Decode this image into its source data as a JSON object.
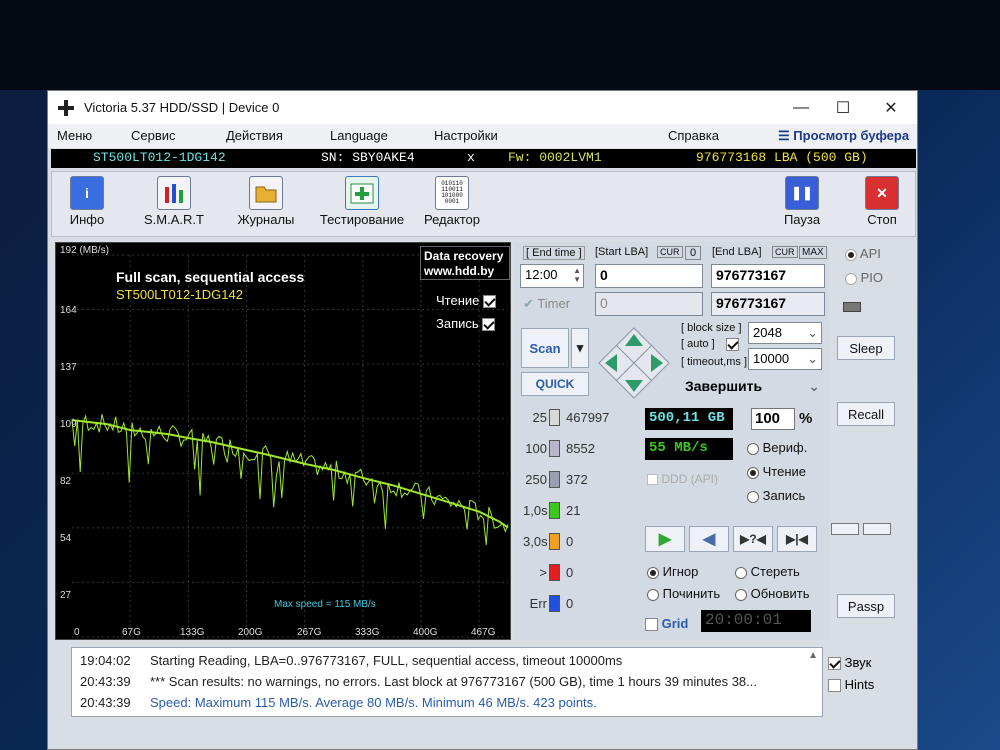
{
  "window": {
    "title": "Victoria 5.37 HDD/SSD | Device 0",
    "min": "—",
    "max": "☐",
    "close": "✕"
  },
  "menu": {
    "items": [
      "Меню",
      "Сервис",
      "Действия",
      "Language",
      "Настройки",
      "Справка"
    ],
    "buffer": "Просмотр буфера"
  },
  "device": {
    "model": "ST500LT012-1DG142",
    "serial": "SN: SBY0AKE4",
    "x": "x",
    "firmware": "Fw: 0002LVM1",
    "lba": "976773168 LBA (500 GB)"
  },
  "toolbar": {
    "info": "Инфо",
    "smart": "S.M.A.R.T",
    "logs": "Журналы",
    "testing": "Тестирование",
    "editor": "Редактор",
    "pause": "Пауза",
    "stop": "Стоп",
    "editor_icon_text": "010110\n110011\n101000\n0001"
  },
  "graph": {
    "ymax_label": "192 (MB/s)",
    "title": "Full scan, sequential access",
    "model": "ST500LT012-1DG142",
    "recovery_line1": "Data recovery",
    "recovery_line2": "www.hdd.by",
    "read_label": "Чтение",
    "write_label": "Запись",
    "max_speed": "Max speed = 115 MB/s",
    "yticks": [
      "164",
      "137",
      "109",
      "82",
      "54",
      "27",
      "0"
    ],
    "xticks": [
      "67G",
      "133G",
      "200G",
      "267G",
      "333G",
      "400G",
      "467G"
    ]
  },
  "chart_data": {
    "type": "line",
    "title": "Full scan, sequential access",
    "ylabel": "(MB/s)",
    "ylim": [
      0,
      192
    ],
    "xlim_gb": [
      0,
      500
    ],
    "series": [
      {
        "name": "Чтение",
        "color": "#9ee82e",
        "x": [
          0,
          20,
          40,
          67,
          90,
          110,
          133,
          160,
          180,
          200,
          230,
          267,
          300,
          333,
          370,
          400,
          430,
          467,
          490,
          500
        ],
        "y": [
          109,
          108,
          107,
          104,
          103,
          102,
          100,
          98,
          96,
          94,
          91,
          87,
          84,
          80,
          76,
          72,
          68,
          63,
          58,
          55
        ]
      }
    ]
  },
  "controls": {
    "end_time_label": "[ End time ]",
    "start_lba_label": "[Start LBA]",
    "cur": "CUR",
    "zero": "0",
    "end_lba_label": "[End LBA]",
    "max": "MAX",
    "end_time": "12:00",
    "start_lba": "0",
    "end_lba": "976773167",
    "timer_label": "Timer",
    "timer_lba": "0",
    "end_lba2": "976773167",
    "scan": "Scan",
    "quick": "QUICK",
    "block_size_label": "[ block size ]",
    "auto_label": "[ auto ]",
    "timeout_label": "[ timeout,ms ]",
    "block_size": "2048",
    "timeout": "10000",
    "finish": "Завершить"
  },
  "stats": [
    {
      "n": "25",
      "value": "467997",
      "color": "#d8d8d8"
    },
    {
      "n": "100",
      "value": "8552",
      "color": "#b8b8c8"
    },
    {
      "n": "250",
      "value": "372",
      "color": "#9aa0b0"
    },
    {
      "n": "1,0s",
      "value": "21",
      "color": "#3cc81e"
    },
    {
      "n": "3,0s",
      "value": "0",
      "color": "#f0a020"
    },
    {
      "n": ">",
      "value": "0",
      "color": "#e02020"
    },
    {
      "n": "Err",
      "value": "0",
      "color": "#2050e0"
    }
  ],
  "progress": {
    "size": "500,11 GB",
    "percent": "100",
    "percent_sign": "%",
    "speed": "55 MB/s",
    "ddd": "DDD (API)"
  },
  "modes": {
    "verify": "Вериф.",
    "read": "Чтение",
    "write": "Запись"
  },
  "actions": {
    "ignore": "Игнор",
    "erase": "Стереть",
    "fix": "Починить",
    "refresh": "Обновить"
  },
  "grid": {
    "label": "Grid",
    "timer": "20:00:01"
  },
  "side": {
    "api": "API",
    "pio": "PIO",
    "sleep": "Sleep",
    "recall": "Recall",
    "passp": "Passp"
  },
  "log": [
    {
      "time": "19:04:02",
      "text": "Starting Reading, LBA=0..976773167, FULL, sequential access, timeout 10000ms",
      "color": "#222222"
    },
    {
      "time": "20:43:39",
      "text": "*** Scan results: no warnings, no errors. Last block at 976773167 (500 GB), time 1 hours 39 minutes 38...",
      "color": "#222222"
    },
    {
      "time": "20:43:39",
      "text": "Speed: Maximum 115 MB/s. Average 80 MB/s. Minimum 46 MB/s. 423 points.",
      "color": "#2a5cab"
    }
  ],
  "logside": {
    "sound": "Звук",
    "hints": "Hints"
  }
}
